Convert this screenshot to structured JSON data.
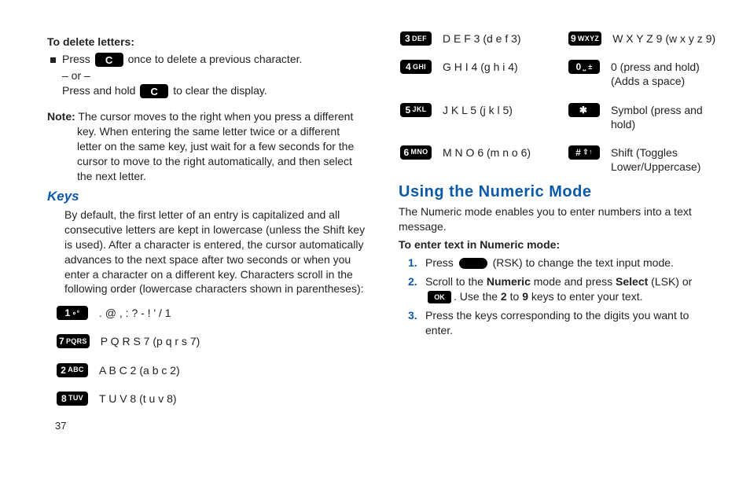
{
  "left": {
    "delete_heading": "To delete letters:",
    "press1a": "Press ",
    "press1b": " once to delete a previous character.",
    "or": "– or –",
    "press2a": "Press and hold ",
    "press2b": " to clear the display.",
    "note_label": "Note:",
    "note_body": " The cursor moves to the right when you press a different key. When entering the same letter twice or a different letter on the same key, just wait for a few seconds for the cursor to move to the right automatically, and then select the next letter.",
    "keys_heading": "Keys",
    "keys_body": "By default, the first letter of an entry is capitalized and all consecutive letters are kept in lowercase (unless the Shift key is used). After a character is entered, the cursor automatically advances to the next space after two seconds or when you enter a character on a different key. Characters scroll in the following order (lowercase characters shown in parentheses):",
    "page_number": "37"
  },
  "keys_left": [
    {
      "digit": "1",
      "cap": "∘°",
      "text": ". @ , : ? - !  ' / 1"
    },
    {
      "digit": "2",
      "cap": "ABC",
      "text": "A B C 2 (a b c 2)"
    },
    {
      "digit": "7",
      "cap": "PQRS",
      "text": "P Q R S 7 (p q r s 7)"
    },
    {
      "digit": "8",
      "cap": "TUV",
      "text": "T U V 8 (t u v 8)"
    }
  ],
  "keys_right": [
    {
      "digit": "3",
      "cap": "DEF",
      "text": "D E F 3 (d e f 3)"
    },
    {
      "digit": "9",
      "cap": "WXYZ",
      "text": "W X Y Z 9 (w x y z 9)"
    },
    {
      "digit": "4",
      "cap": "GHI",
      "text": "G H I 4 (g h i 4)"
    },
    {
      "digit": "0",
      "cap": "⎵ ±",
      "text": "0 (press and hold) (Adds a space)"
    },
    {
      "digit": "5",
      "cap": "JKL",
      "text": "J K L 5 (j k l 5)"
    },
    {
      "digit": "✱",
      "cap": "",
      "text": "Symbol (press and hold)"
    },
    {
      "digit": "6",
      "cap": "MNO",
      "text": "M N O 6 (m n o 6)"
    },
    {
      "digit": "#",
      "cap": "⇧↑",
      "text": "Shift (Toggles Lower/Uppercase)"
    }
  ],
  "numeric": {
    "heading": "Using the Numeric Mode",
    "intro": "The Numeric mode enables you to enter numbers into a text message.",
    "sub": "To enter text in Numeric mode:",
    "s1a": "Press ",
    "s1b": " (RSK) to change the text input mode.",
    "s2a": "Scroll to the ",
    "s2b": "Numeric",
    "s2c": " mode and press ",
    "s2d": "Select",
    "s2e": " (LSK) or ",
    "s2f": ". Use the ",
    "s2g": "2",
    "s2h": " to ",
    "s2i": "9",
    "s2j": " keys to enter your text.",
    "s3": "Press the keys corresponding to the digits you want to enter.",
    "ok": "OK"
  }
}
